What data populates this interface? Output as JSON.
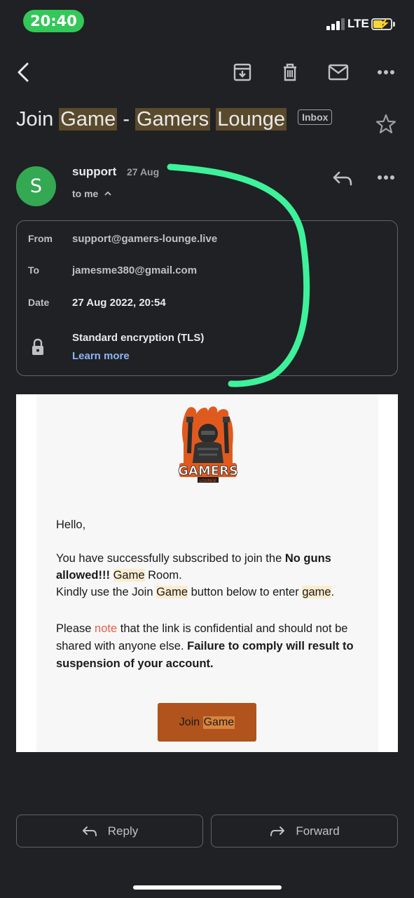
{
  "status": {
    "time": "20:40",
    "network": "LTE"
  },
  "toolbar": {
    "back": "back-arrow-icon",
    "archive": "archive-icon",
    "delete": "trash-icon",
    "mark_unread": "mail-icon",
    "more": "more-vert-icon"
  },
  "subject": {
    "w1": "Join",
    "w2": "Game",
    "sep": "-",
    "w3": "Gamers",
    "w4": "Lounge",
    "badge": "Inbox"
  },
  "message": {
    "avatar_letter": "S",
    "sender": "support",
    "date": "27 Aug",
    "to": "to me",
    "details": {
      "from_label": "From",
      "from_value": "support@gamers-lounge.live",
      "to_label": "To",
      "to_value": "jamesme380@gmail.com",
      "date_label": "Date",
      "date_value": "27 Aug 2022, 20:54",
      "encryption": "Standard encryption (TLS)",
      "learn_more": "Learn more"
    }
  },
  "email": {
    "greeting": "Hello,",
    "p1_a": "You have successfully subscribed to join the ",
    "p1_bold": "No guns allowed!!!",
    "p1_hl": "Game",
    "p1_b": " Room.",
    "p2_a": "Kindly use the Join ",
    "p2_hl": "Game",
    "p2_b": " button below to enter ",
    "p2_hl2": "game",
    "p2_c": ".",
    "p3_a": "Please ",
    "p3_note": "note",
    "p3_b": " that the link is confidential and should not be shared with anyone else. ",
    "p3_bold": "Failure to comply will result to suspension of your account.",
    "button_a": "Join ",
    "button_b": "Game",
    "logo_text": "GAMERS",
    "logo_sub": "LOUNGE"
  },
  "actions": {
    "reply": "Reply",
    "forward": "Forward"
  },
  "colors": {
    "background": "#202124",
    "avatar": "#34a853",
    "link": "#8ab4f8",
    "annotation": "#3df29a",
    "button": "#b0531c",
    "highlight": "#5a4a2c"
  }
}
